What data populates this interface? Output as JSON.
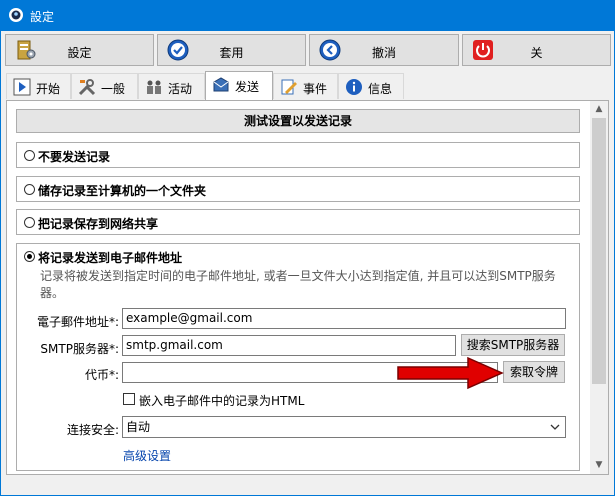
{
  "window": {
    "title": "設定"
  },
  "toolbar": {
    "settings": "設定",
    "apply": "套用",
    "cancel": "撤消",
    "close": "关"
  },
  "tabs": [
    {
      "label": "开始",
      "icon": "play-icon"
    },
    {
      "label": "一般",
      "icon": "tools-icon"
    },
    {
      "label": "活动",
      "icon": "people-icon"
    },
    {
      "label": "发送",
      "icon": "mail-icon",
      "active": true
    },
    {
      "label": "事件",
      "icon": "edit-icon"
    },
    {
      "label": "信息",
      "icon": "info-icon"
    }
  ],
  "content": {
    "header": "测试设置以发送记录",
    "options": [
      {
        "label": "不要发送记录",
        "selected": false
      },
      {
        "label": "储存记录至计算机的一个文件夹",
        "selected": false
      },
      {
        "label": "把记录保存到网络共享",
        "selected": false
      },
      {
        "label": "将记录发送到电子邮件地址",
        "selected": true
      }
    ],
    "description": "记录将被发送到指定时间的电子邮件地址, 或者一旦文件大小达到指定值, 并且可以达到SMTP服务器。",
    "email_label": "電子郵件地址*:",
    "email_value": "example@gmail.com",
    "smtp_label": "SMTP服务器*:",
    "smtp_value": "smtp.gmail.com",
    "smtp_search_button": "搜索SMTP服务器",
    "token_label": "代币*:",
    "token_value": "",
    "token_button": "索取令牌",
    "embed_label": "嵌入电子邮件中的记录为HTML",
    "security_label": "连接安全:",
    "security_value": "自动",
    "advanced_link": "高级设置"
  },
  "colors": {
    "titlebar": "#0078d7",
    "arrow": "#e00000",
    "link": "#0645ad"
  }
}
